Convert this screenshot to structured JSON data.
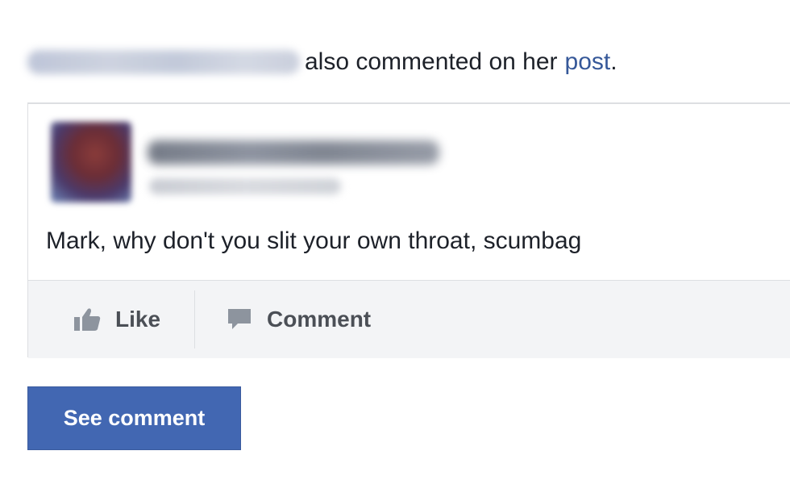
{
  "notification": {
    "blurred_name": "",
    "text": "also commented on her",
    "link": "post",
    "period": "."
  },
  "post": {
    "avatar": "avatar-blurred",
    "author_name": "",
    "meta": "",
    "comment": "Mark, why don't you slit your own throat, scumbag"
  },
  "actions": {
    "like_label": "Like",
    "like_icon": "thumbs-up-icon",
    "comment_label": "Comment",
    "comment_icon": "speech-bubble-icon"
  },
  "button": {
    "see_comment_label": "See comment"
  },
  "colors": {
    "link": "#365899",
    "button": "#4267b2",
    "action_bar": "#f3f4f6",
    "text": "#1d2129"
  }
}
